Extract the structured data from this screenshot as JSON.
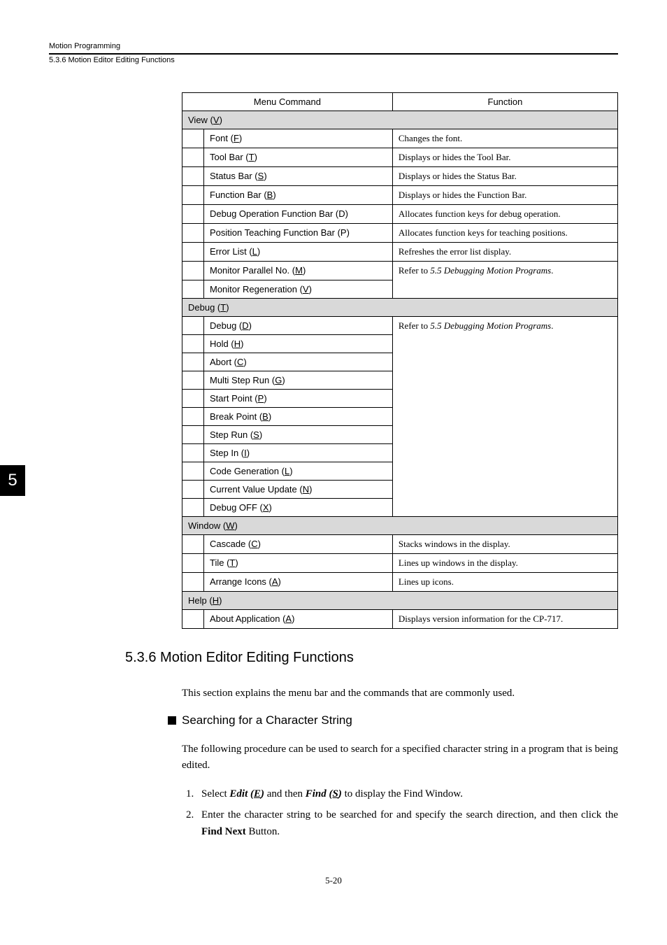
{
  "header": {
    "title": "Motion Programming",
    "sub": "5.3.6  Motion Editor Editing Functions"
  },
  "badge": "5",
  "table": {
    "col1": "Menu Command",
    "col2": "Function",
    "sections": {
      "view": {
        "label_pre": "View (",
        "label_u": "V",
        "label_post": ")",
        "rows": [
          {
            "cmd_pre": "Font (",
            "cmd_u": "F",
            "cmd_post": ")",
            "func": "Changes the font."
          },
          {
            "cmd_pre": "Tool Bar (",
            "cmd_u": "T",
            "cmd_post": ")",
            "func": "Displays or hides the Tool Bar."
          },
          {
            "cmd_pre": "Status Bar (",
            "cmd_u": "S",
            "cmd_post": ")",
            "func": "Displays or hides the Status Bar."
          },
          {
            "cmd_pre": "Function Bar (",
            "cmd_u": "B",
            "cmd_post": ")",
            "func": "Displays or hides the Function Bar."
          },
          {
            "cmd_pre": "Debug Operation Function Bar (D)",
            "cmd_u": "",
            "cmd_post": "",
            "func": "Allocates function keys for debug operation."
          },
          {
            "cmd_pre": "Position Teaching Function Bar (P)",
            "cmd_u": "",
            "cmd_post": "",
            "func": "Allocates function keys for teaching positions."
          },
          {
            "cmd_pre": "Error List (",
            "cmd_u": "L",
            "cmd_post": ")",
            "func": "Refreshes the error list display."
          },
          {
            "cmd_pre": "Monitor Parallel No. (",
            "cmd_u": "M",
            "cmd_post": ")",
            "func_pre": "Refer to ",
            "func_italic": "5.5 Debugging Motion Programs",
            "func_post": "."
          },
          {
            "cmd_pre": "Monitor Regeneration (",
            "cmd_u": "V",
            "cmd_post": ")",
            "func": ""
          }
        ]
      },
      "debug": {
        "label_pre": "Debug (",
        "label_u": "T",
        "label_post": ")",
        "func_pre": "Refer to ",
        "func_italic": "5.5 Debugging Motion Programs",
        "func_post": ".",
        "rows": [
          {
            "cmd_pre": "Debug (",
            "cmd_u": "D",
            "cmd_post": ")"
          },
          {
            "cmd_pre": "Hold (",
            "cmd_u": "H",
            "cmd_post": ")"
          },
          {
            "cmd_pre": "Abort (",
            "cmd_u": "C",
            "cmd_post": ")"
          },
          {
            "cmd_pre": "Multi Step Run (",
            "cmd_u": "G",
            "cmd_post": ")"
          },
          {
            "cmd_pre": "Start Point (",
            "cmd_u": "P",
            "cmd_post": ")"
          },
          {
            "cmd_pre": "Break Point (",
            "cmd_u": "B",
            "cmd_post": ")"
          },
          {
            "cmd_pre": "Step Run (",
            "cmd_u": "S",
            "cmd_post": ")"
          },
          {
            "cmd_pre": "Step In (",
            "cmd_u": "I",
            "cmd_post": ")"
          },
          {
            "cmd_pre": "Code Generation (",
            "cmd_u": "L",
            "cmd_post": ")"
          },
          {
            "cmd_pre": "Current Value Update (",
            "cmd_u": "N",
            "cmd_post": ")"
          },
          {
            "cmd_pre": "Debug OFF (",
            "cmd_u": "X",
            "cmd_post": ")"
          }
        ]
      },
      "window": {
        "label_pre": "Window (",
        "label_u": "W",
        "label_post": ")",
        "rows": [
          {
            "cmd_pre": "Cascade (",
            "cmd_u": "C",
            "cmd_post": ")",
            "func": "Stacks windows in the display."
          },
          {
            "cmd_pre": "Tile (",
            "cmd_u": "T",
            "cmd_post": ")",
            "func": "Lines up windows in the display."
          },
          {
            "cmd_pre": "Arrange Icons (",
            "cmd_u": "A",
            "cmd_post": ")",
            "func": "Lines up icons."
          }
        ]
      },
      "help": {
        "label_pre": "Help (",
        "label_u": "H",
        "label_post": ")",
        "rows": [
          {
            "cmd_pre": "About Application (",
            "cmd_u": "A",
            "cmd_post": ")",
            "func": "Displays version information for the CP-717."
          }
        ]
      }
    }
  },
  "section": {
    "heading": "5.3.6  Motion Editor Editing Functions",
    "intro": "This section explains the menu bar and the commands that are commonly used.",
    "sub_heading": "Searching for a Character String",
    "body1": "The following procedure can be used to search for a specified character string in a program that is being edited.",
    "ol": {
      "r1": {
        "num": "1.",
        "pre": "Select ",
        "bi1": "Edit (",
        "bi1u": "E",
        "bi1post": ")",
        "mid": " and then ",
        "bi2": "Find (",
        "bi2u": "S",
        "bi2post": ")",
        "post": " to display the Find Window."
      },
      "r2": {
        "num": "2.",
        "pre": "Enter the character string to be searched for and specify the search direction, and then click the ",
        "bold": "Find Next",
        "post": " Button."
      }
    }
  },
  "page_num": "5-20"
}
